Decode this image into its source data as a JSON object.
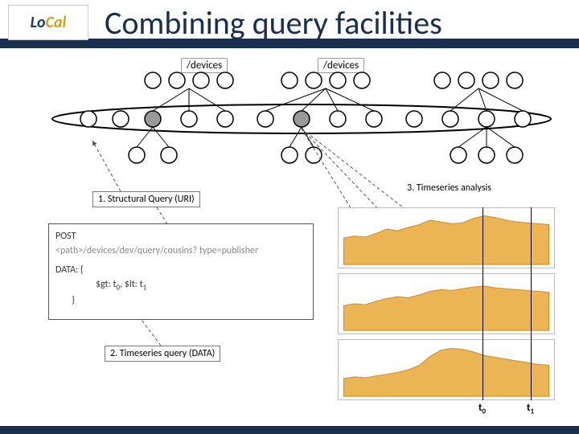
{
  "header": {
    "logo_lo": "Lo",
    "logo_cal": "Cal",
    "title": "Combining query facilities"
  },
  "tree": {
    "label_left": "/devices",
    "label_right": "/devices"
  },
  "steps": {
    "s1": "1.   Structural Query (URI)",
    "s2": "2.   Timeseries query (DATA)",
    "s3": "3.   Timeseries analysis"
  },
  "code": {
    "post": "POST",
    "path": "<path>/devices/dev/query/cousins? type=publisher",
    "data_label": "DATA: {",
    "gt": "$gt: t",
    "gt_sub": "0",
    "sep": ", ",
    "lt": "$lt: t",
    "lt_sub": "1",
    "close": "}"
  },
  "time_labels": {
    "t0": "t",
    "t0_sub": "0",
    "t1": "t",
    "t1_sub": "1"
  },
  "chart_data": [
    {
      "type": "area",
      "title": "",
      "x": [
        0,
        1,
        2,
        3,
        4,
        5,
        6,
        7,
        8,
        9,
        10,
        11,
        12,
        13,
        14,
        15,
        16,
        17,
        18,
        19
      ],
      "values": [
        30,
        32,
        31,
        35,
        40,
        38,
        42,
        45,
        50,
        48,
        46,
        47,
        52,
        55,
        53,
        50,
        48,
        47,
        46,
        45
      ],
      "xlabel": "",
      "ylabel": "",
      "ylim": [
        0,
        60
      ]
    },
    {
      "type": "area",
      "title": "",
      "x": [
        0,
        1,
        2,
        3,
        4,
        5,
        6,
        7,
        8,
        9,
        10,
        11,
        12,
        13,
        14,
        15,
        16,
        17,
        18,
        19
      ],
      "values": [
        28,
        30,
        29,
        33,
        36,
        38,
        37,
        40,
        44,
        46,
        45,
        47,
        49,
        50,
        48,
        47,
        46,
        45,
        44,
        43
      ],
      "xlabel": "",
      "ylabel": "",
      "ylim": [
        0,
        60
      ]
    },
    {
      "type": "area",
      "title": "",
      "x": [
        0,
        1,
        2,
        3,
        4,
        5,
        6,
        7,
        8,
        9,
        10,
        11,
        12,
        13,
        14,
        15,
        16,
        17,
        18,
        19
      ],
      "values": [
        20,
        22,
        21,
        23,
        25,
        27,
        30,
        35,
        45,
        52,
        54,
        53,
        50,
        46,
        44,
        42,
        40,
        38,
        36,
        35
      ],
      "xlabel": "",
      "ylabel": "",
      "ylim": [
        0,
        60
      ]
    }
  ]
}
